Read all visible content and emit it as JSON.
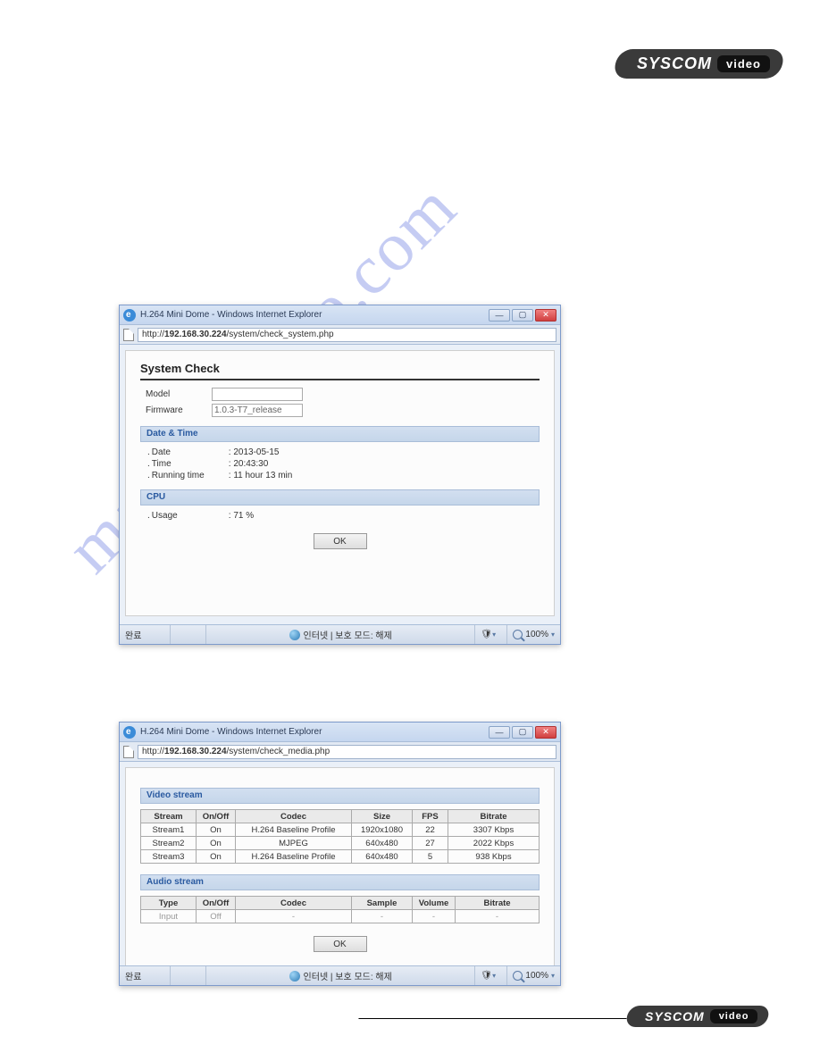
{
  "brand": {
    "name": "SYSCOM",
    "suffix": "video"
  },
  "watermark": "manualshive.com",
  "window1": {
    "title": "H.264 Mini Dome - Windows Internet Explorer",
    "url_prefix": "http://",
    "url_host": "192.168.30.224",
    "url_path": "/system/check_system.php",
    "heading": "System Check",
    "model_label": "Model",
    "model_value": "",
    "firmware_label": "Firmware",
    "firmware_value": "1.0.3-T7_release",
    "sect_datetime": "Date & Time",
    "date_label": "Date",
    "date_value": ": 2013-05-15",
    "time_label": "Time",
    "time_value": ": 20:43:30",
    "running_label": "Running time",
    "running_value": ": 11 hour 13 min",
    "sect_cpu": "CPU",
    "usage_label": "Usage",
    "usage_value": ": 71 %",
    "ok": "OK",
    "status_left": "완료",
    "status_center": "인터넷 | 보호 모드: 해제",
    "zoom": "100%"
  },
  "window2": {
    "title": "H.264 Mini Dome - Windows Internet Explorer",
    "url_prefix": "http://",
    "url_host": "192.168.30.224",
    "url_path": "/system/check_media.php",
    "sect_video": "Video stream",
    "video_headers": [
      "Stream",
      "On/Off",
      "Codec",
      "Size",
      "FPS",
      "Bitrate"
    ],
    "video_rows": [
      [
        "Stream1",
        "On",
        "H.264 Baseline Profile",
        "1920x1080",
        "22",
        "3307 Kbps"
      ],
      [
        "Stream2",
        "On",
        "MJPEG",
        "640x480",
        "27",
        "2022 Kbps"
      ],
      [
        "Stream3",
        "On",
        "H.264 Baseline Profile",
        "640x480",
        "5",
        "938 Kbps"
      ]
    ],
    "sect_audio": "Audio stream",
    "audio_headers": [
      "Type",
      "On/Off",
      "Codec",
      "Sample",
      "Volume",
      "Bitrate"
    ],
    "audio_rows": [
      [
        "Input",
        "Off",
        "-",
        "-",
        "-",
        "-"
      ]
    ],
    "ok": "OK",
    "status_left": "완료",
    "status_center": "인터넷 | 보호 모드: 해제",
    "zoom": "100%"
  }
}
